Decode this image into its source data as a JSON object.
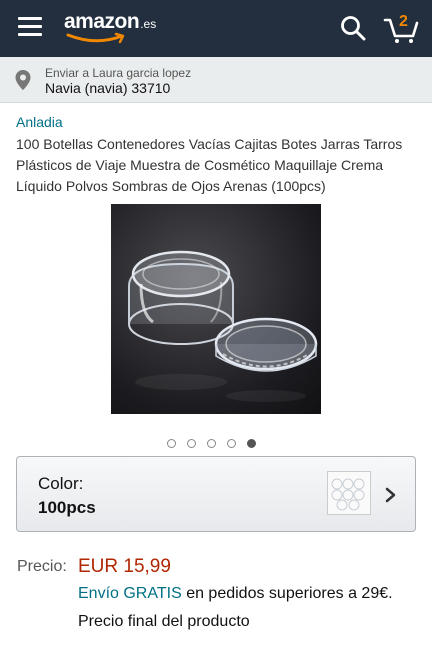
{
  "header": {
    "logo_text": "amazon",
    "logo_tld": ".es",
    "cart_count": "2",
    "background": "#232f3e",
    "accent": "#f08804"
  },
  "delivery": {
    "line1": "Enviar a Laura garcia lopez",
    "line2": "Navia (navia) 33710"
  },
  "product": {
    "brand": "Anladia",
    "title": "100 Botellas Contenedores Vacías Cajitas Botes Jarras Tarros Plásticos de Viaje Muestra de Cosmético Maquillaje Crema Líquido Polvos Sombras de Ojos Arenas (100pcs)",
    "image_count": 5,
    "active_image_index": 5
  },
  "variant": {
    "label": "Color:",
    "value": "100pcs"
  },
  "price": {
    "label": "Precio:",
    "value": "EUR 15,99",
    "color": "#b12704"
  },
  "shipping": {
    "link_text": "Envío GRATIS",
    "rest_text": "en pedidos superiores a 29€.",
    "final_text": "Precio final del producto"
  },
  "colors": {
    "link": "#007185",
    "deliver_bar": "#eaeded"
  }
}
